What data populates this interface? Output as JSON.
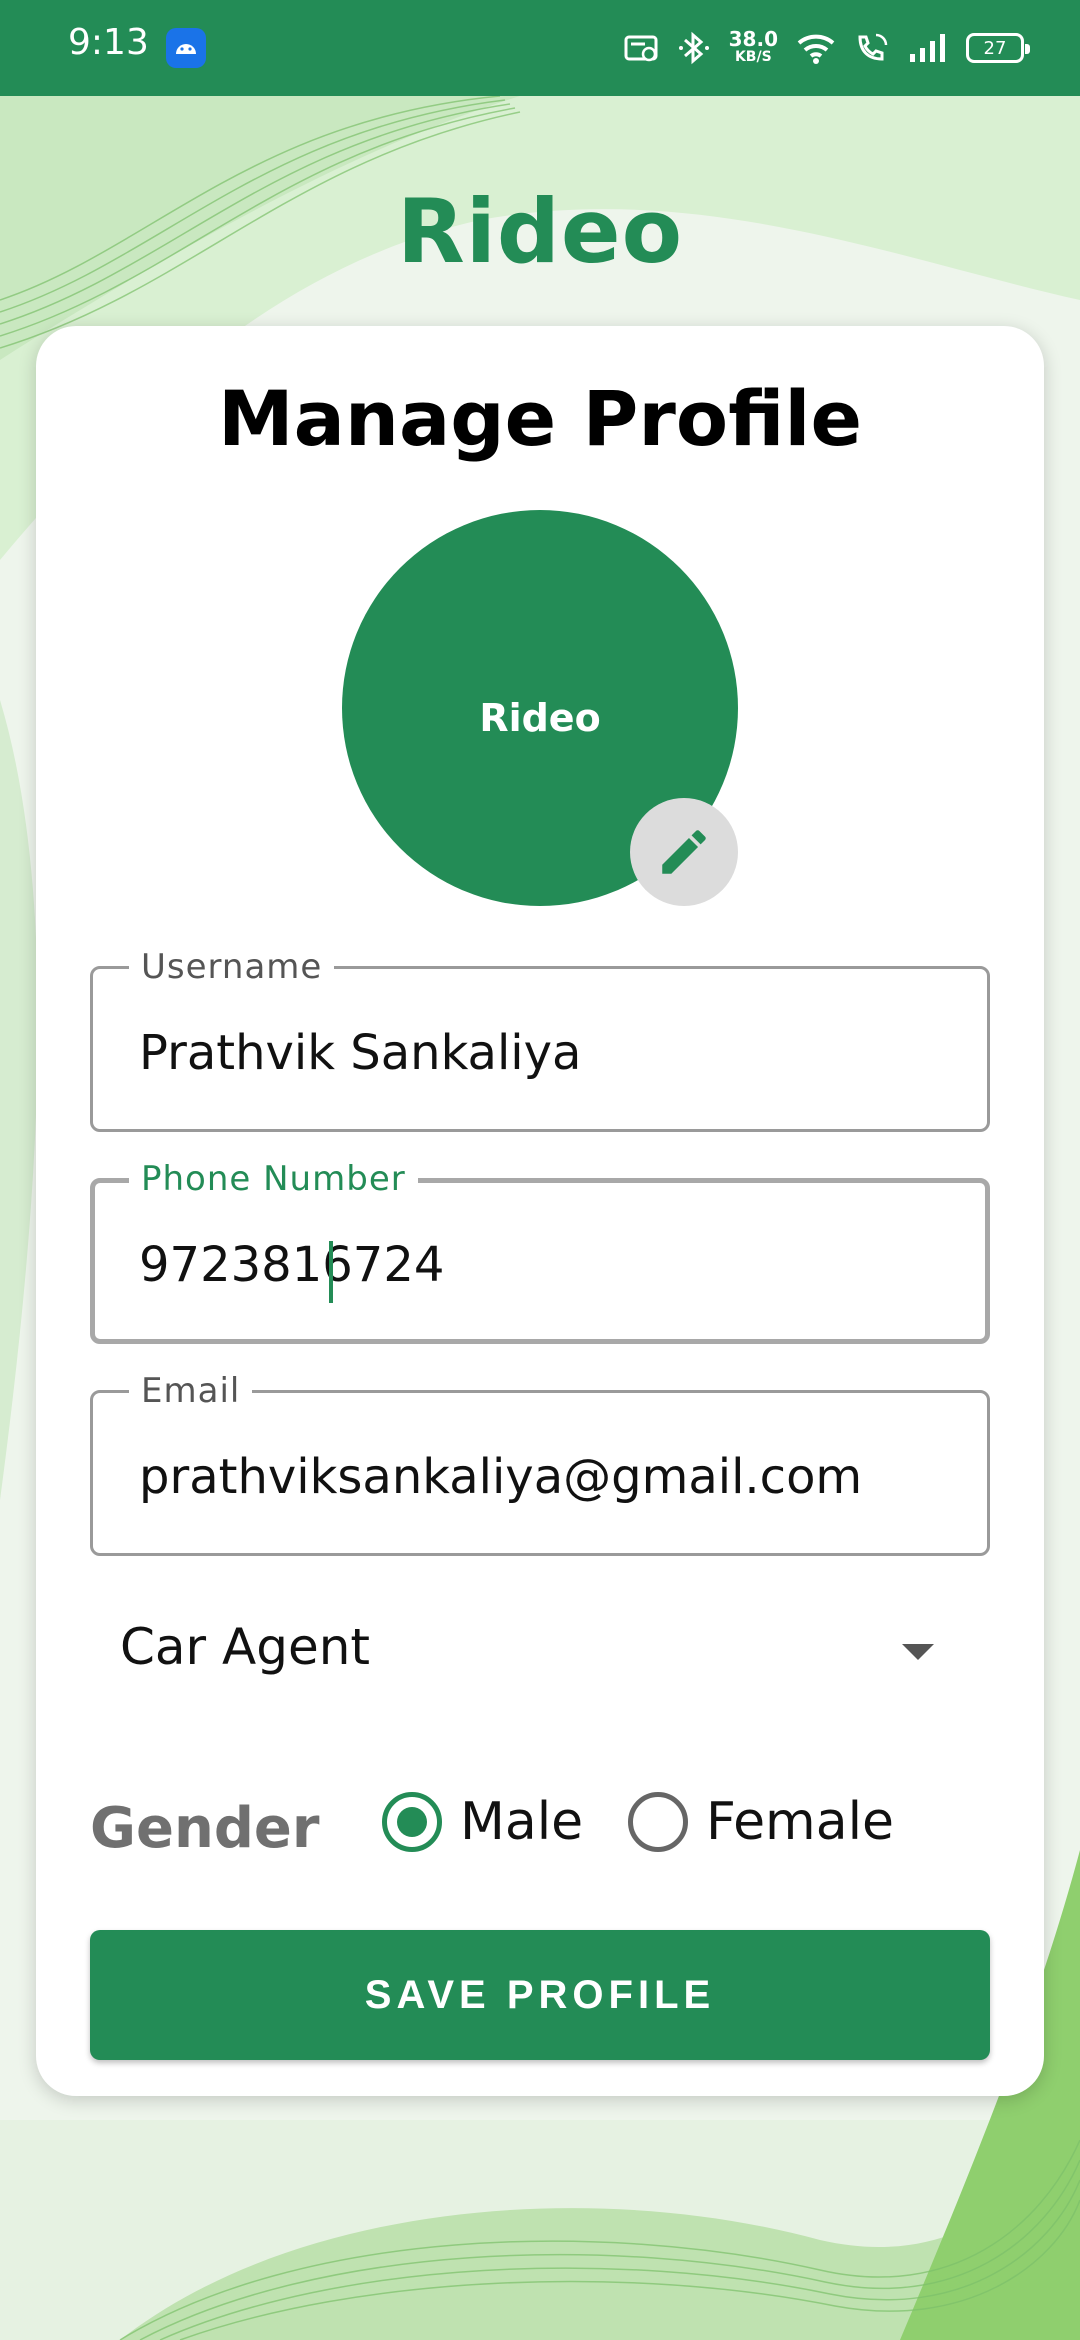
{
  "status_bar": {
    "time": "9:13",
    "speed_value": "38.0",
    "speed_unit": "KB/S",
    "battery": "27",
    "icons": [
      "android-app-icon",
      "no-sim-icon",
      "bluetooth-icon",
      "wifi-icon",
      "wifi-call-icon",
      "signal-icon",
      "battery-icon"
    ]
  },
  "app": {
    "title": "Rideo",
    "accent_color": "#238c56"
  },
  "card": {
    "title": "Manage Profile",
    "avatar_text": "Rideo",
    "edit_icon": "pencil-icon"
  },
  "form": {
    "username": {
      "label": "Username",
      "value": "Prathvik Sankaliya"
    },
    "phone": {
      "label": "Phone Number",
      "value": "9723816724"
    },
    "email": {
      "label": "Email",
      "value": "prathviksankaliya@gmail.com"
    },
    "role": {
      "selected": "Car Agent"
    },
    "gender": {
      "label": "Gender",
      "options": [
        {
          "label": "Male",
          "checked": true
        },
        {
          "label": "Female",
          "checked": false
        }
      ]
    },
    "save_label": "SAVE PROFILE"
  }
}
